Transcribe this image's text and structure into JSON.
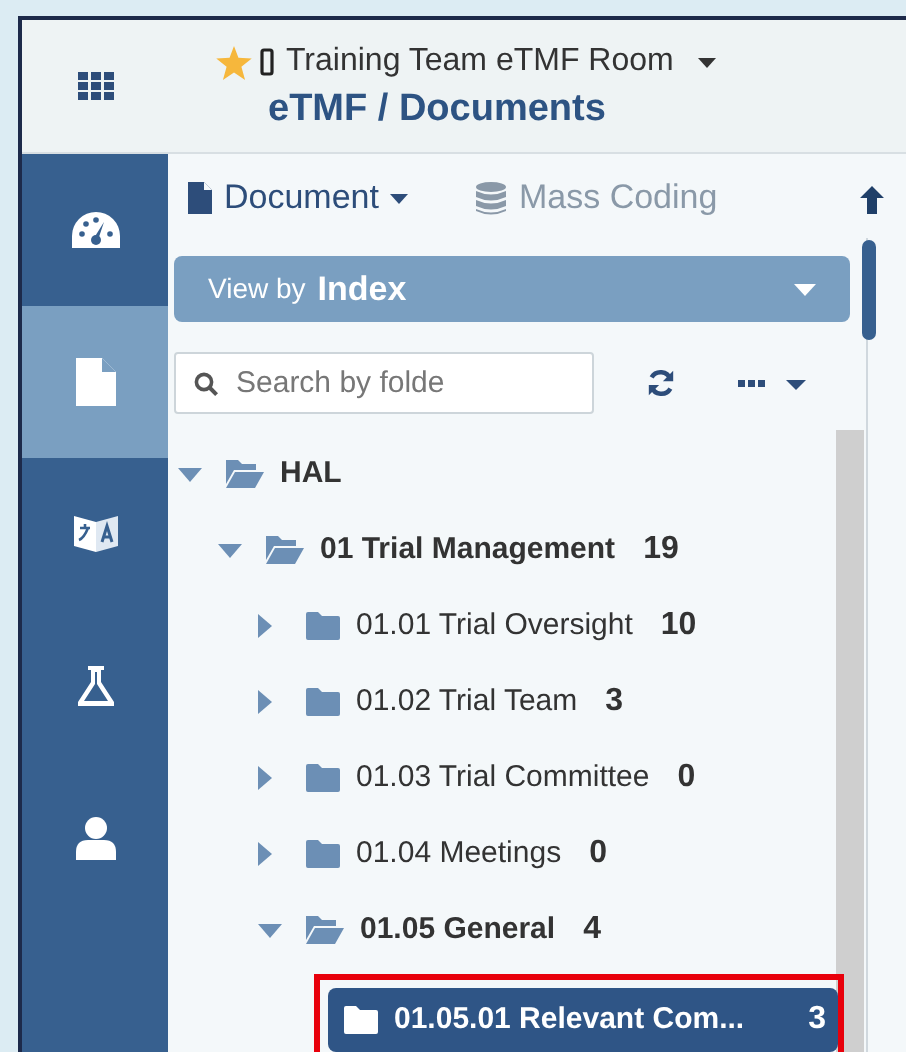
{
  "header": {
    "room_title": "Training Team eTMF Room",
    "favorite": true,
    "breadcrumb": "eTMF / Documents"
  },
  "sidebar": {
    "items": [
      {
        "kind": "dashboard",
        "selected": false
      },
      {
        "kind": "document",
        "selected": true
      },
      {
        "kind": "translate",
        "selected": false
      },
      {
        "kind": "flask",
        "selected": false
      },
      {
        "kind": "user",
        "selected": false
      }
    ]
  },
  "toolbar": {
    "items": [
      {
        "kind": "document",
        "label": "Document",
        "disabled": false
      },
      {
        "kind": "database",
        "label": "Mass Coding",
        "disabled": true
      }
    ]
  },
  "view_by": {
    "label": "View by",
    "value": "Index"
  },
  "search": {
    "placeholder": "Search by folde"
  },
  "tree": [
    {
      "label": "HAL",
      "expanded": true,
      "selected": false,
      "children": [
        {
          "label": "01 Trial Management",
          "count": "19",
          "expanded": true,
          "selected": false,
          "children": [
            {
              "label": "01.01 Trial Oversight",
              "count": "10",
              "expanded": false,
              "selected": false
            },
            {
              "label": "01.02 Trial Team",
              "count": "3",
              "expanded": false,
              "selected": false
            },
            {
              "label": "01.03 Trial Committee",
              "count": "0",
              "expanded": false,
              "selected": false
            },
            {
              "label": "01.04 Meetings",
              "count": "0",
              "expanded": false,
              "selected": false
            },
            {
              "label": "01.05 General",
              "count": "4",
              "expanded": true,
              "selected": false,
              "children": [
                {
                  "label": "01.05.01 Relevant Com...",
                  "count": "3",
                  "selected": true,
                  "highlighted": true
                }
              ]
            }
          ]
        }
      ]
    }
  ]
}
